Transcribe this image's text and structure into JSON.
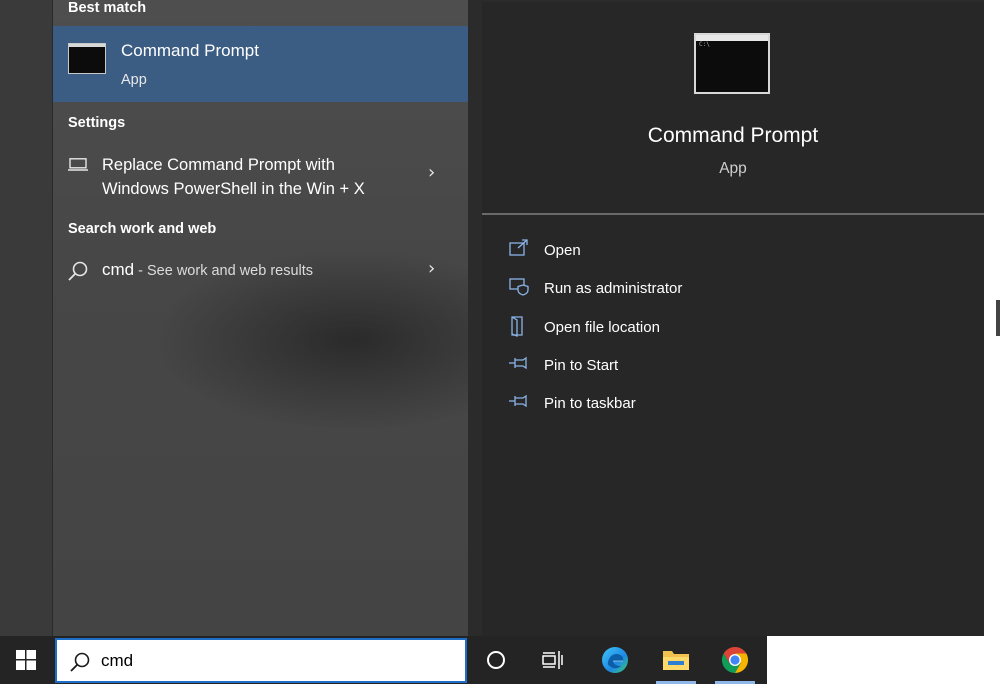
{
  "search_results": {
    "best_match": {
      "heading": "Best match",
      "title": "Command Prompt",
      "subtitle": "App"
    },
    "settings": {
      "heading": "Settings",
      "item_line1": "Replace Command Prompt with",
      "item_line2": "Windows PowerShell in the Win + X"
    },
    "web": {
      "heading": "Search work and web",
      "query": "cmd",
      "suffix": " - See work and web results"
    }
  },
  "detail_panel": {
    "title": "Command Prompt",
    "subtitle": "App",
    "actions": [
      {
        "label": "Open",
        "icon": "open-icon"
      },
      {
        "label": "Run as administrator",
        "icon": "shield-icon"
      },
      {
        "label": "Open file location",
        "icon": "file-location-icon"
      },
      {
        "label": "Pin to Start",
        "icon": "pin-icon"
      },
      {
        "label": "Pin to taskbar",
        "icon": "pin-icon"
      }
    ]
  },
  "taskbar": {
    "search_value": "cmd",
    "apps": [
      "cortana-icon",
      "task-view-icon",
      "edge-icon",
      "file-explorer-icon",
      "chrome-icon"
    ]
  },
  "colors": {
    "accent_selected": "#3c5d83",
    "icon_blue": "#8ab4e8",
    "search_border": "#1e6ec8"
  }
}
